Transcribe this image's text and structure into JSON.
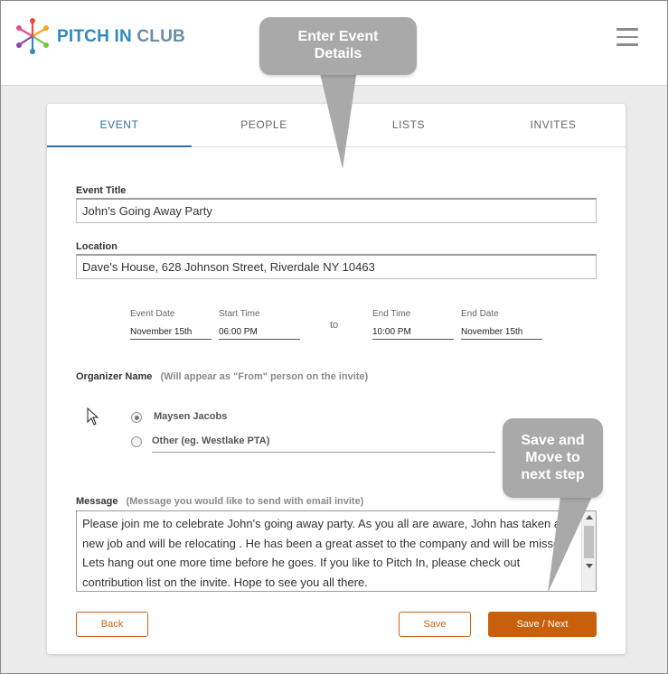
{
  "header": {
    "logo_part1": "PITCH IN",
    "logo_part2": "CLUB",
    "menu_icon": "hamburger-menu-icon"
  },
  "tabs": [
    {
      "label": "EVENT",
      "active": true
    },
    {
      "label": "PEOPLE",
      "active": false
    },
    {
      "label": "LISTS",
      "active": false
    },
    {
      "label": "INVITES",
      "active": false
    }
  ],
  "form": {
    "event_title_label": "Event Title",
    "event_title_value": "John's Going Away Party",
    "location_label": "Location",
    "location_value": "Dave's House,  628 Johnson Street,  Riverdale  NY 10463",
    "event_date_label": "Event Date",
    "event_date_value": "November 15th",
    "start_time_label": "Start Time",
    "start_time_value": "06:00 PM",
    "to_label": "to",
    "end_time_label": "End Time",
    "end_time_value": "10:00 PM",
    "end_date_label": "End Date",
    "end_date_value": "November 15th",
    "organizer_label": "Organizer Name",
    "organizer_hint": "(Will appear as \"From\" person on the invite)",
    "organizer_option1": "Maysen Jacobs",
    "organizer_option2": "Other (eg. Westlake PTA)",
    "message_label": "Message",
    "message_hint": "(Message you would like to send with email invite)",
    "message_value": "Please join me to celebrate John's going away party.  As you all are aware,  John has taken a new job and will be relocating . He has been a great asset to the company and will be missed.  Lets hang out one more time before he goes.  If you like to Pitch In,  please check out contribution list on the invite. Hope to see you all there."
  },
  "buttons": {
    "back": "Back",
    "save": "Save",
    "save_next": "Save / Next"
  },
  "callouts": {
    "enter_event": "Enter Event\nDetails",
    "save_move": "Save and\nMove to\nnext step"
  },
  "colors": {
    "accent_blue": "#2f6fa7",
    "accent_orange": "#c85f0b",
    "callout_gray": "#a9a9a9"
  }
}
